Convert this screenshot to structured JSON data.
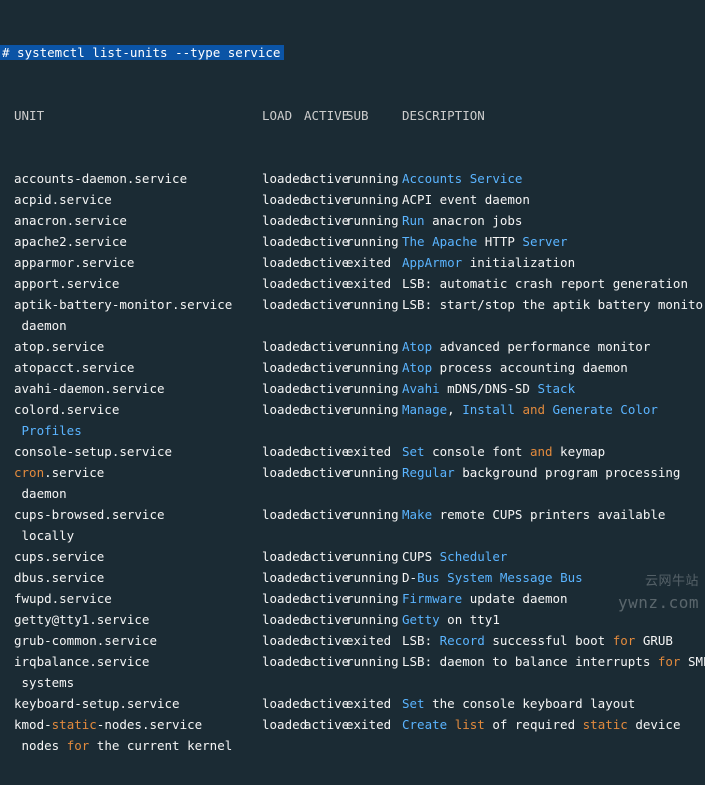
{
  "command": "# systemctl list-units --type service",
  "header": {
    "unit": "UNIT",
    "load": "LOAD",
    "active": "ACTIVE",
    "sub": "SUB",
    "desc": "DESCRIPTION"
  },
  "rows": [
    {
      "unit": "accounts-daemon.service",
      "load": "loaded",
      "active": "active",
      "sub": "running",
      "desc": [
        {
          "t": "Accounts",
          "c": "c-blue"
        },
        {
          "t": " ",
          "c": "c-white"
        },
        {
          "t": "Service",
          "c": "c-blue"
        }
      ]
    },
    {
      "unit": "acpid.service",
      "load": "loaded",
      "active": "active",
      "sub": "running",
      "desc": [
        {
          "t": "ACPI event daemon",
          "c": "c-white"
        }
      ]
    },
    {
      "unit": "anacron.service",
      "load": "loaded",
      "active": "active",
      "sub": "running",
      "desc": [
        {
          "t": "Run",
          "c": "c-blue"
        },
        {
          "t": " anacron jobs",
          "c": "c-white"
        }
      ]
    },
    {
      "unit": "apache2.service",
      "load": "loaded",
      "active": "active",
      "sub": "running",
      "desc": [
        {
          "t": "The",
          "c": "c-blue"
        },
        {
          "t": " ",
          "c": "c-white"
        },
        {
          "t": "Apache",
          "c": "c-blue"
        },
        {
          "t": " HTTP ",
          "c": "c-white"
        },
        {
          "t": "Server",
          "c": "c-blue"
        }
      ]
    },
    {
      "unit": "apparmor.service",
      "load": "loaded",
      "active": "active",
      "sub": "exited",
      "desc": [
        {
          "t": "AppArmor",
          "c": "c-blue"
        },
        {
          "t": " initialization",
          "c": "c-white"
        }
      ]
    },
    {
      "unit": "apport.service",
      "load": "loaded",
      "active": "active",
      "sub": "exited",
      "desc": [
        {
          "t": "LSB: automatic crash report generation",
          "c": "c-white"
        }
      ]
    },
    {
      "unit": "aptik-battery-monitor.service",
      "load": "loaded",
      "active": "active",
      "sub": "running",
      "desc": [
        {
          "t": "LSB: start/stop the aptik battery monitor",
          "c": "c-white"
        }
      ],
      "wrap": " daemon"
    },
    {
      "unit": "atop.service",
      "load": "loaded",
      "active": "active",
      "sub": "running",
      "desc": [
        {
          "t": "Atop",
          "c": "c-blue"
        },
        {
          "t": " advanced performance monitor",
          "c": "c-white"
        }
      ]
    },
    {
      "unit": "atopacct.service",
      "load": "loaded",
      "active": "active",
      "sub": "running",
      "desc": [
        {
          "t": "Atop",
          "c": "c-blue"
        },
        {
          "t": " process accounting daemon",
          "c": "c-white"
        }
      ]
    },
    {
      "unit": "avahi-daemon.service",
      "load": "loaded",
      "active": "active",
      "sub": "running",
      "desc": [
        {
          "t": "Avahi",
          "c": "c-blue"
        },
        {
          "t": " mDNS/DNS-SD ",
          "c": "c-white"
        },
        {
          "t": "Stack",
          "c": "c-blue"
        }
      ]
    },
    {
      "unit": "colord.service",
      "load": "loaded",
      "active": "active",
      "sub": "running",
      "desc": [
        {
          "t": "Manage",
          "c": "c-blue"
        },
        {
          "t": ", ",
          "c": "c-white"
        },
        {
          "t": "Install",
          "c": "c-blue"
        },
        {
          "t": " ",
          "c": "c-white"
        },
        {
          "t": "and",
          "c": "c-orange"
        },
        {
          "t": " ",
          "c": "c-white"
        },
        {
          "t": "Generate",
          "c": "c-blue"
        },
        {
          "t": " ",
          "c": "c-white"
        },
        {
          "t": "Color",
          "c": "c-blue"
        }
      ],
      "wrap_parts": [
        {
          "t": " ",
          "c": "c-white"
        },
        {
          "t": "Profiles",
          "c": "c-blue"
        }
      ]
    },
    {
      "unit": "console-setup.service",
      "load": "loaded",
      "active": "active",
      "sub": "exited",
      "desc": [
        {
          "t": "Set",
          "c": "c-blue"
        },
        {
          "t": " console font ",
          "c": "c-white"
        },
        {
          "t": "and",
          "c": "c-orange"
        },
        {
          "t": " keymap",
          "c": "c-white"
        }
      ]
    },
    {
      "unit_parts": [
        {
          "t": "cron",
          "c": "c-orange"
        },
        {
          "t": ".service",
          "c": "c-white"
        }
      ],
      "load": "loaded",
      "active": "active",
      "sub": "running",
      "desc": [
        {
          "t": "Regular",
          "c": "c-blue"
        },
        {
          "t": " background program processing",
          "c": "c-white"
        }
      ],
      "wrap": " daemon"
    },
    {
      "unit": "cups-browsed.service",
      "load": "loaded",
      "active": "active",
      "sub": "running",
      "desc": [
        {
          "t": "Make",
          "c": "c-blue"
        },
        {
          "t": " remote CUPS printers available",
          "c": "c-white"
        }
      ],
      "wrap": " locally"
    },
    {
      "unit": "cups.service",
      "load": "loaded",
      "active": "active",
      "sub": "running",
      "desc": [
        {
          "t": "CUPS ",
          "c": "c-white"
        },
        {
          "t": "Scheduler",
          "c": "c-blue"
        }
      ]
    },
    {
      "unit": "dbus.service",
      "load": "loaded",
      "active": "active",
      "sub": "running",
      "desc": [
        {
          "t": "D-",
          "c": "c-white"
        },
        {
          "t": "Bus",
          "c": "c-blue"
        },
        {
          "t": " ",
          "c": "c-white"
        },
        {
          "t": "System",
          "c": "c-blue"
        },
        {
          "t": " ",
          "c": "c-white"
        },
        {
          "t": "Message",
          "c": "c-blue"
        },
        {
          "t": " ",
          "c": "c-white"
        },
        {
          "t": "Bus",
          "c": "c-blue"
        }
      ]
    },
    {
      "unit": "fwupd.service",
      "load": "loaded",
      "active": "active",
      "sub": "running",
      "desc": [
        {
          "t": "Firmware",
          "c": "c-blue"
        },
        {
          "t": " update daemon",
          "c": "c-white"
        }
      ]
    },
    {
      "unit": "getty@tty1.service",
      "load": "loaded",
      "active": "active",
      "sub": "running",
      "desc": [
        {
          "t": "Getty",
          "c": "c-blue"
        },
        {
          "t": " on tty1",
          "c": "c-white"
        }
      ]
    },
    {
      "unit": "grub-common.service",
      "load": "loaded",
      "active": "active",
      "sub": "exited",
      "desc": [
        {
          "t": "LSB: ",
          "c": "c-white"
        },
        {
          "t": "Record",
          "c": "c-blue"
        },
        {
          "t": " successful boot ",
          "c": "c-white"
        },
        {
          "t": "for",
          "c": "c-orange"
        },
        {
          "t": " GRUB",
          "c": "c-white"
        }
      ]
    },
    {
      "unit": "irqbalance.service",
      "load": "loaded",
      "active": "active",
      "sub": "running",
      "desc": [
        {
          "t": "LSB: daemon to balance interrupts ",
          "c": "c-white"
        },
        {
          "t": "for",
          "c": "c-orange"
        },
        {
          "t": " SMP",
          "c": "c-white"
        }
      ],
      "wrap": " systems"
    },
    {
      "unit": "keyboard-setup.service",
      "load": "loaded",
      "active": "active",
      "sub": "exited",
      "desc": [
        {
          "t": "Set",
          "c": "c-blue"
        },
        {
          "t": " the console keyboard layout",
          "c": "c-white"
        }
      ]
    },
    {
      "unit_parts": [
        {
          "t": "kmod-",
          "c": "c-white"
        },
        {
          "t": "static",
          "c": "c-orange"
        },
        {
          "t": "-nodes.service",
          "c": "c-white"
        }
      ],
      "load": "loaded",
      "active": "active",
      "sub": "exited",
      "desc": [
        {
          "t": "Create",
          "c": "c-blue"
        },
        {
          "t": " ",
          "c": "c-white"
        },
        {
          "t": "list",
          "c": "c-orange"
        },
        {
          "t": " of required ",
          "c": "c-white"
        },
        {
          "t": "static",
          "c": "c-orange"
        },
        {
          "t": " device",
          "c": "c-white"
        }
      ],
      "wrap_parts": [
        {
          "t": " nodes ",
          "c": "c-white"
        },
        {
          "t": "for",
          "c": "c-orange"
        },
        {
          "t": " the current kernel",
          "c": "c-white"
        }
      ]
    }
  ],
  "watermark": {
    "line1": "云网牛站",
    "line2": "ywnz.com"
  }
}
